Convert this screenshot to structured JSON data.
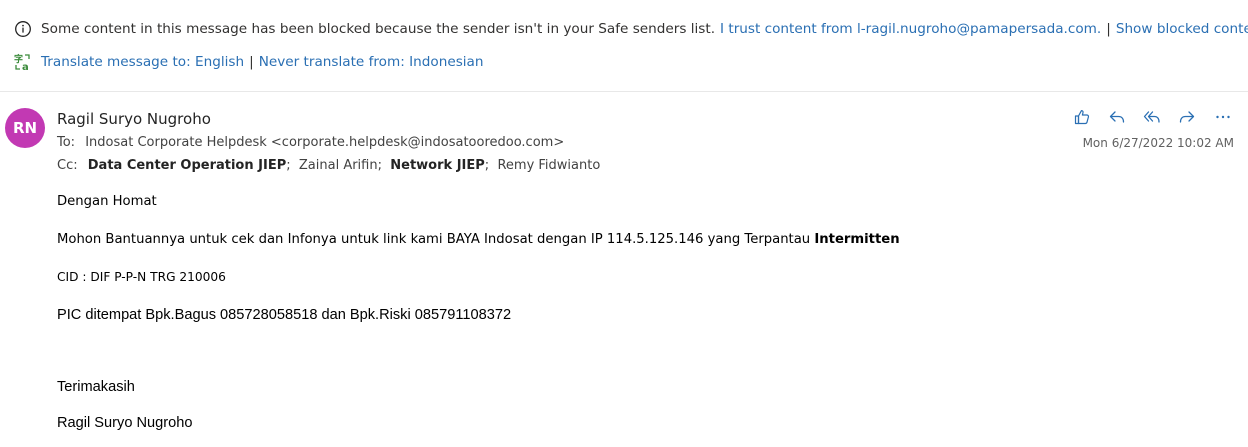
{
  "banner": {
    "blocked_text": "Some content in this message has been blocked because the sender isn't in your Safe senders list.",
    "trust_link": "I trust content from l-ragil.nugroho@pamapersada.com.",
    "separator": "|",
    "show_blocked_link": "Show blocked content",
    "translate_link": "Translate message to: English",
    "never_translate_link": "Never translate from: Indonesian",
    "icons": {
      "info": "info-icon",
      "translate": "translate-icon"
    }
  },
  "message": {
    "avatar_initials": "RN",
    "avatar_color": "#c239b3",
    "sender_name": "Ragil Suryo Nugroho",
    "to_label": "To:",
    "to_value": "Indosat Corporate Helpdesk <corporate.helpdesk@indosatooredoo.com>",
    "cc_label": "Cc:",
    "cc_recipients": [
      {
        "name": "Data Center Operation JIEP",
        "bold": true
      },
      {
        "name": "Zainal Arifin",
        "bold": false
      },
      {
        "name": "Network JIEP",
        "bold": true
      },
      {
        "name": "Remy Fidwianto",
        "bold": false
      }
    ],
    "cc_separator": ";",
    "timestamp": "Mon 6/27/2022 10:02 AM",
    "actions": [
      {
        "name": "like",
        "icon": "thumbs-up-icon"
      },
      {
        "name": "reply",
        "icon": "reply-icon"
      },
      {
        "name": "reply-all",
        "icon": "reply-all-icon"
      },
      {
        "name": "forward",
        "icon": "forward-icon"
      },
      {
        "name": "more",
        "icon": "more-icon"
      }
    ],
    "accent_color": "#2a6fb3"
  },
  "body": {
    "greeting": "Dengan Homat",
    "request_text": "Mohon Bantuannya untuk cek dan Infonya untuk link kami BAYA Indosat dengan IP 114.5.125.146 yang Terpantau",
    "request_bold": "Intermitten",
    "cid": "CID : DIF P-P-N TRG 210006",
    "pic": "PIC ditempat Bpk.Bagus 085728058518 dan Bpk.Riski 085791108372",
    "closing": "Terimakasih",
    "signature": "Ragil Suryo Nugroho"
  }
}
